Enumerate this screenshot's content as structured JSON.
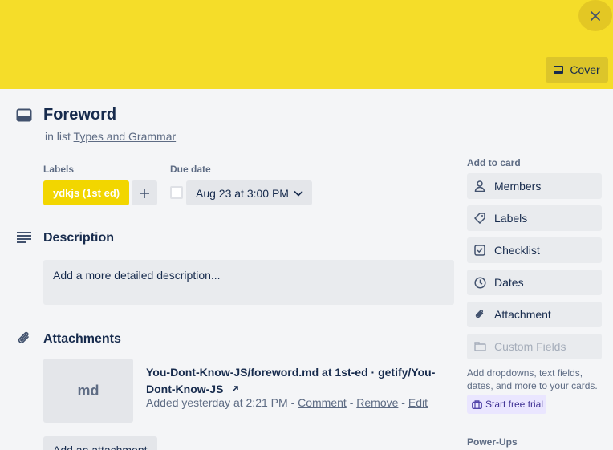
{
  "cover": {
    "button_label": "Cover",
    "color": "#f5dd29"
  },
  "card": {
    "title": "Foreword",
    "in_list_prefix": "in list",
    "list_name": "Types and Grammar"
  },
  "labels": {
    "heading": "Labels",
    "items": [
      {
        "text": "ydkjs (1st ed)",
        "color": "#f2d600"
      }
    ],
    "add_icon": "plus-icon"
  },
  "due_date": {
    "heading": "Due date",
    "value": "Aug 23 at 3:00 PM",
    "checked": false
  },
  "description": {
    "heading": "Description",
    "placeholder": "Add a more detailed description..."
  },
  "attachments": {
    "heading": "Attachments",
    "items": [
      {
        "thumb_text": "md",
        "name": "You-Dont-Know-JS/foreword.md at 1st-ed · getify/You-Dont-Know-JS",
        "added": "Added yesterday at 2:21 PM",
        "sep": "-",
        "comment": "Comment",
        "remove": "Remove",
        "edit": "Edit"
      }
    ],
    "add_button": "Add an attachment"
  },
  "sidebar": {
    "add_to_card_heading": "Add to card",
    "buttons": [
      {
        "label": "Members",
        "icon": "person-icon"
      },
      {
        "label": "Labels",
        "icon": "tag-icon"
      },
      {
        "label": "Checklist",
        "icon": "checklist-icon"
      },
      {
        "label": "Dates",
        "icon": "clock-icon"
      },
      {
        "label": "Attachment",
        "icon": "paperclip-icon"
      },
      {
        "label": "Custom Fields",
        "icon": "custom-fields-icon",
        "disabled": true
      }
    ],
    "custom_fields_note": "Add dropdowns, text fields, dates, and more to your cards.",
    "trial_button": "Start free trial",
    "powerups_heading": "Power-Ups"
  }
}
